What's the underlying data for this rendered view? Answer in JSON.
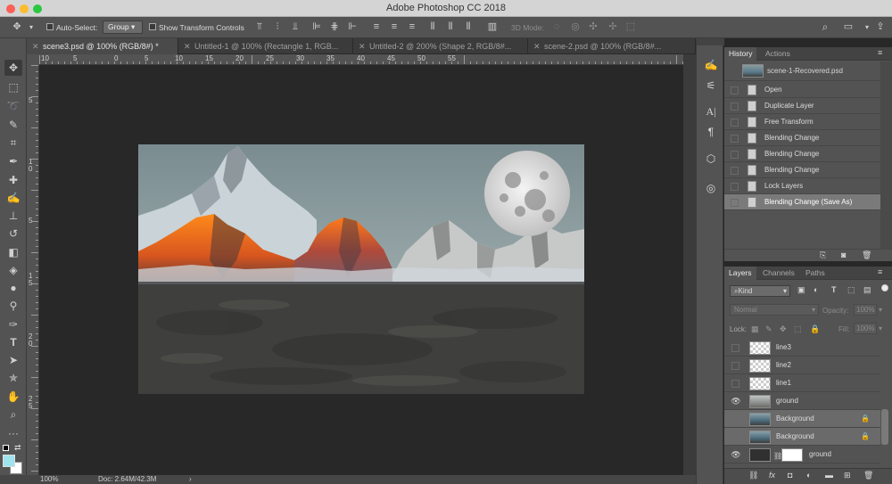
{
  "app": {
    "title": "Adobe Photoshop CC 2018"
  },
  "options": {
    "auto_select_label": "Auto-Select:",
    "auto_select_value": "Group",
    "show_transform_label": "Show Transform Controls",
    "mode_3d_label": "3D Mode:"
  },
  "tabs": [
    {
      "label": "scene3.psd @ 100% (RGB/8#) *"
    },
    {
      "label": "Untitled-1 @ 100% (Rectangle 1, RGB..."
    },
    {
      "label": "Untitled-2 @ 200% (Shape 2, RGB/8#..."
    },
    {
      "label": "scene-2.psd @ 100% (RGB/8#..."
    }
  ],
  "ruler": {
    "h_ticks": [
      "10",
      "5",
      "0",
      "5",
      "10",
      "15",
      "20",
      "25",
      "30",
      "35",
      "40",
      "45",
      "50",
      "55"
    ],
    "v_ticks": [
      "5",
      "1",
      "0",
      "5",
      "1",
      "5",
      "2",
      "0",
      "2",
      "5"
    ]
  },
  "status": {
    "zoom": "100%",
    "doc": "Doc: 2.64M/42.3M"
  },
  "history": {
    "tabs": [
      "History",
      "Actions"
    ],
    "snapshot": "scene-1-Recovered.psd",
    "steps": [
      "Open",
      "Duplicate Layer",
      "Free Transform",
      "Blending Change",
      "Blending Change",
      "Blending Change",
      "Lock Layers",
      "Blending Change (Save As)"
    ]
  },
  "layers": {
    "tabs": [
      "Layers",
      "Channels",
      "Paths"
    ],
    "kind_label": "Kind",
    "blend_mode": "Normal",
    "opacity_label": "Opacity:",
    "opacity_value": "100%",
    "lock_label": "Lock:",
    "fill_label": "Fill:",
    "fill_value": "100%",
    "items": [
      {
        "name": "line3"
      },
      {
        "name": "line2"
      },
      {
        "name": "line1"
      },
      {
        "name": "ground"
      },
      {
        "name": "Background"
      },
      {
        "name": "Background"
      },
      {
        "name": "ground"
      }
    ]
  },
  "colors": {
    "accent": "#9fe3ee",
    "panel": "#535353",
    "canvas_bg": "#282828"
  }
}
